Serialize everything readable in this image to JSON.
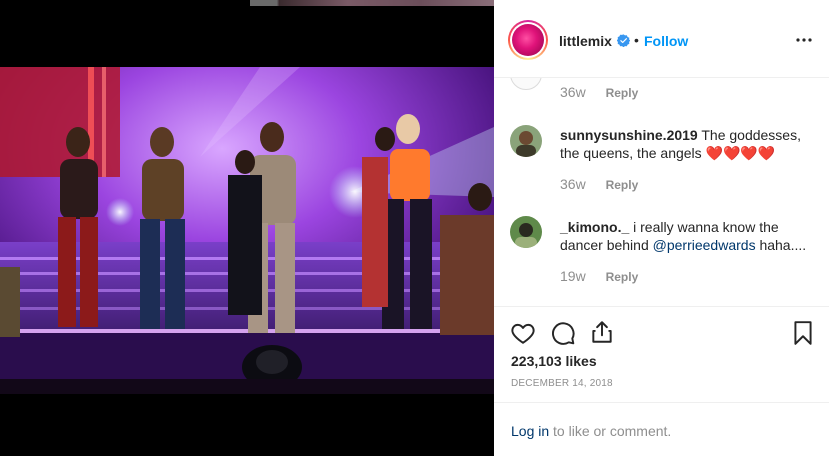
{
  "header": {
    "username": "littlemix",
    "separator": "•",
    "follow_label": "Follow"
  },
  "comments": {
    "previous": {
      "time": "36w",
      "reply_label": "Reply"
    },
    "items": [
      {
        "username": "sunnysunshine.2019",
        "text": "The goddesses, the queens, the angels ❤️❤️❤️❤️",
        "time": "36w",
        "reply_label": "Reply"
      },
      {
        "username": "_kimono._",
        "text_before": "i really wanna know the dancer behind ",
        "mention": "@perrieedwards",
        "text_after": " haha....",
        "time": "19w",
        "reply_label": "Reply"
      }
    ]
  },
  "actions": {
    "icons": [
      "heart-icon",
      "comment-icon",
      "share-icon",
      "bookmark-icon"
    ],
    "likes": "223,103 likes",
    "date": "DECEMBER 14, 2018"
  },
  "footer": {
    "login_link": "Log in",
    "login_rest": " to like or comment."
  },
  "colors": {
    "accent": "#0095f6",
    "mention": "#00376b",
    "muted": "#8e8e8e",
    "text": "#262626"
  }
}
